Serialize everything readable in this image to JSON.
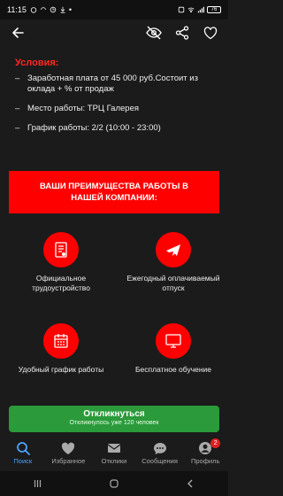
{
  "status_bar": {
    "time": "11:15",
    "battery": "76"
  },
  "conditions": {
    "title": "Условия:",
    "items": [
      "Заработная плата от 45 000 руб.Состоит из оклада + % от продаж",
      "Место работы: ТРЦ Галерея",
      "График работы: 2/2 (10:00 - 23:00)"
    ]
  },
  "banner": {
    "text": "ВАШИ ПРЕИМУЩЕСТВА РАБОТЫ В НАШЕЙ КОМПАНИИ:"
  },
  "advantages": [
    {
      "icon": "document-icon",
      "label": "Официальное трудоустройство"
    },
    {
      "icon": "airplane-icon",
      "label": "Ежегодный оплачиваемый отпуск"
    },
    {
      "icon": "calendar-icon",
      "label": "Удобный график работы"
    },
    {
      "icon": "monitor-icon",
      "label": "Бесплатное обучение"
    }
  ],
  "cta": {
    "label": "Откликнуться",
    "sublabel": "Откликнулось уже 120 человек"
  },
  "bottom_nav": [
    {
      "label": "Поиск",
      "icon": "search-icon",
      "active": true
    },
    {
      "label": "Избранное",
      "icon": "heart-icon",
      "active": false
    },
    {
      "label": "Отклики",
      "icon": "mail-icon",
      "active": false
    },
    {
      "label": "Сообщения",
      "icon": "chat-icon",
      "active": false
    },
    {
      "label": "Профиль",
      "icon": "profile-icon",
      "active": false,
      "badge": "2"
    }
  ],
  "colors": {
    "accent_red": "#ff0000",
    "cta_green": "#2a9a3a",
    "active_blue": "#4aa3ff"
  }
}
